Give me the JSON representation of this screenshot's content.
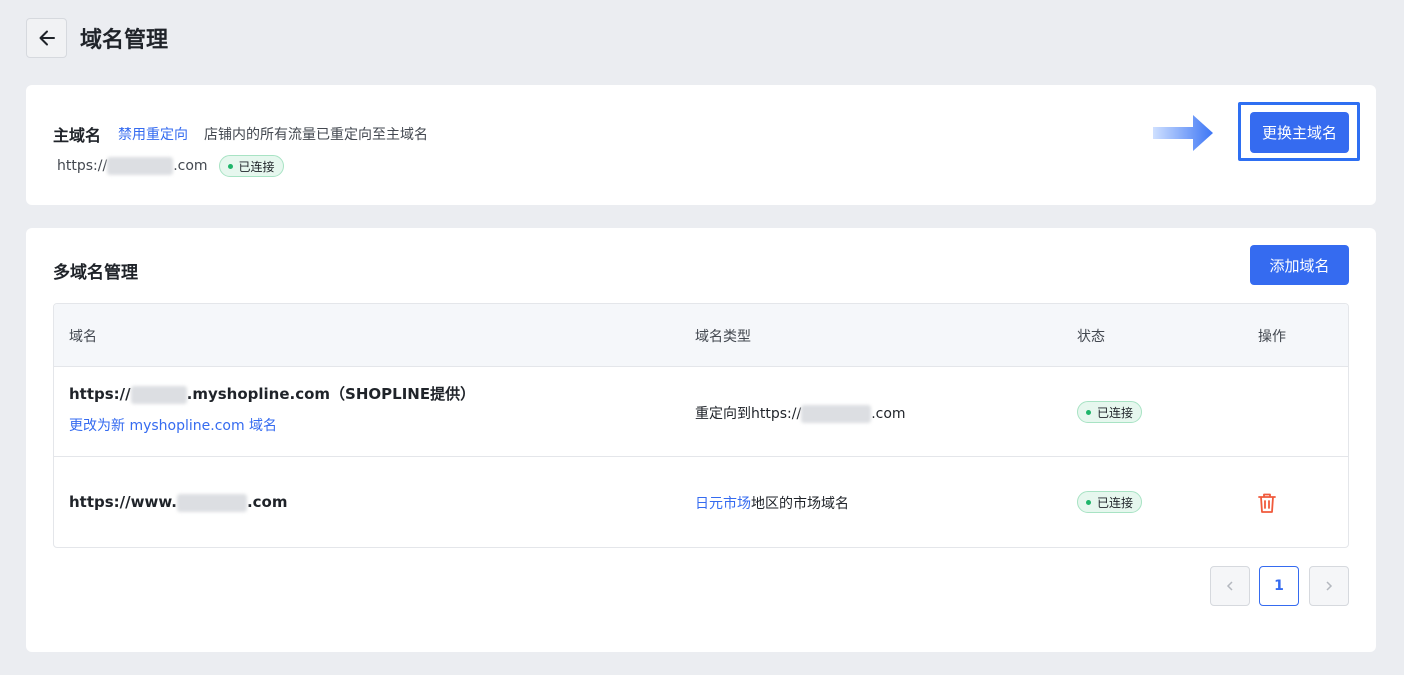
{
  "page": {
    "title": "域名管理"
  },
  "primary": {
    "label": "主域名",
    "disable_redirect_link": "禁用重定向",
    "description": "店铺内的所有流量已重定向至主域名",
    "url_prefix": "https://",
    "url_suffix": ".com",
    "status": "已连接",
    "change_button": "更换主域名"
  },
  "multi": {
    "title": "多域名管理",
    "add_button": "添加域名",
    "columns": {
      "domain": "域名",
      "type": "域名类型",
      "status": "状态",
      "actions": "操作"
    },
    "rows": [
      {
        "domain_prefix": "https://",
        "domain_suffix": ".myshopline.com（SHOPLINE提供）",
        "sub_link": "更改为新 myshopline.com 域名",
        "type_prefix": "重定向到https://",
        "type_suffix": ".com",
        "status": "已连接"
      },
      {
        "domain_prefix": "https://www.",
        "domain_suffix": ".com",
        "type_link": "日元市场",
        "type_text": "地区的市场域名",
        "status": "已连接"
      }
    ]
  },
  "pagination": {
    "current": "1"
  },
  "colors": {
    "accent": "#356bf0",
    "success": "#1fb56a",
    "danger": "#f05a3c",
    "background": "#ebedf1"
  },
  "icons": {
    "back": "arrow-left-icon",
    "trash": "trash-icon",
    "prev": "chevron-left-icon",
    "next": "chevron-right-icon",
    "pointer": "arrow-right-icon"
  }
}
